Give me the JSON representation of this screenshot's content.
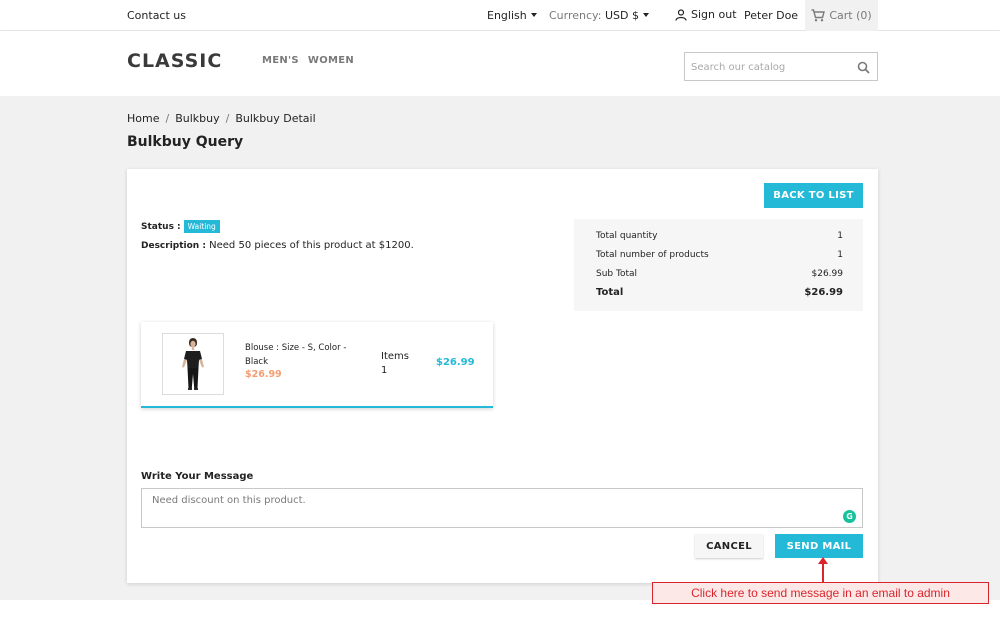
{
  "topbar": {
    "contact": "Contact us",
    "language": "English",
    "currency_label": "Currency:",
    "currency_value": "USD $",
    "sign_out": "Sign out",
    "user_name": "Peter Doe",
    "cart": "Cart (0)"
  },
  "header": {
    "logo": "CLASSIC",
    "nav": [
      "MEN'S",
      "WOMEN"
    ],
    "search_placeholder": "Search our catalog"
  },
  "breadcrumb": [
    "Home",
    "Bulkbuy",
    "Bulkbuy Detail"
  ],
  "page_title": "Bulkbuy Query",
  "card": {
    "back_button": "BACK TO LIST",
    "status_label": "Status :",
    "status_value": "Waiting",
    "description_label": "Description :",
    "description_value": "Need 50 pieces of this product at $1200."
  },
  "totals": [
    {
      "label": "Total quantity",
      "value": "1"
    },
    {
      "label": "Total number of products",
      "value": "1"
    },
    {
      "label": "Sub Total",
      "value": "$26.99"
    },
    {
      "label": "Total",
      "value": "$26.99"
    }
  ],
  "product": {
    "name": "Blouse : Size - S, Color - Black",
    "price": "$26.99",
    "items_label": "Items",
    "items_count": "1",
    "total": "$26.99"
  },
  "message": {
    "label": "Write Your Message",
    "value": "Need discount on this product."
  },
  "buttons": {
    "cancel": "CANCEL",
    "send": "SEND MAIL"
  },
  "annotation": "Click here to send message in an email to admin",
  "colors": {
    "accent": "#24b9d7",
    "price": "#f39d72",
    "annotation": "#d9262c"
  }
}
